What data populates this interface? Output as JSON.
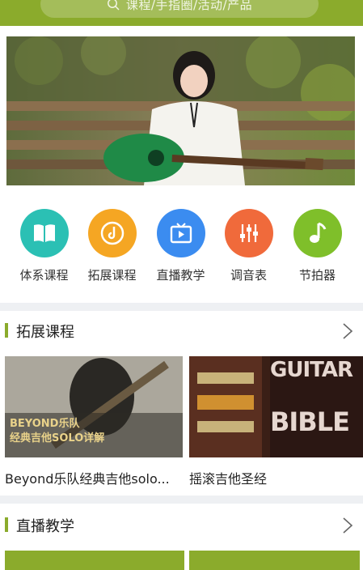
{
  "search": {
    "placeholder": "课程/手指圈/活动/产品"
  },
  "colors": {
    "brand": "#8bab2c",
    "divider": "#eef0f3"
  },
  "nav": [
    {
      "label": "体系课程",
      "icon": "book-icon",
      "color": "#2bc0b4"
    },
    {
      "label": "拓展课程",
      "icon": "disc-icon",
      "color": "#f5a623"
    },
    {
      "label": "直播教学",
      "icon": "tv-play-icon",
      "color": "#3b8cf0"
    },
    {
      "label": "调音表",
      "icon": "sliders-icon",
      "color": "#f06a3b"
    },
    {
      "label": "节拍器",
      "icon": "music-note-icon",
      "color": "#7fbf2a"
    }
  ],
  "sections": {
    "extension": {
      "title": "拓展课程"
    },
    "live": {
      "title": "直播教学"
    }
  },
  "courses": [
    {
      "title": "Beyond乐队经典吉他solo...",
      "cover_text_1": "BEYOND乐队",
      "cover_text_2": "经典吉他SOLO详解"
    },
    {
      "title": "摇滚吉他圣经",
      "cover_text_1": "GUITAR",
      "cover_text_2": "BIBLE"
    }
  ]
}
